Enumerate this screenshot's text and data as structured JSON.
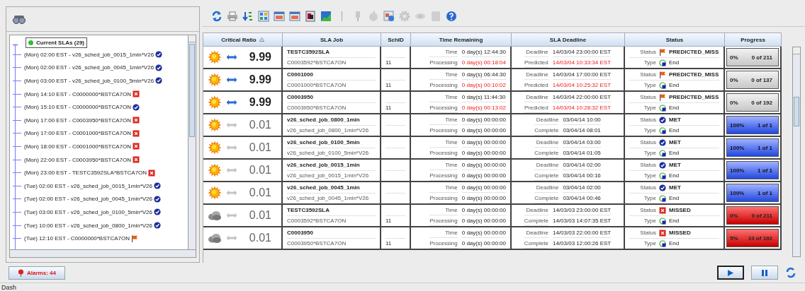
{
  "tree": {
    "root": {
      "label": "Current SLAs (29)",
      "expanded": true
    },
    "items": [
      {
        "label": "(Mon) 02:00 EST - v26_sched_job_0015_1min*V26",
        "kind": "met"
      },
      {
        "label": "(Mon) 02:00 EST - v26_sched_job_0045_1min*V26",
        "kind": "met"
      },
      {
        "label": "(Mon) 03:00 EST - v26_sched_job_0100_5min*V26",
        "kind": "met"
      },
      {
        "label": "(Mon) 14:10 EST - C0000000*BSTCA7ON",
        "kind": "missed"
      },
      {
        "label": "(Mon) 15:10 EST - C0000000*BSTCA7ON",
        "kind": "met"
      },
      {
        "label": "(Mon) 17:00 EST - C0003950*BSTCA7ON",
        "kind": "missed"
      },
      {
        "label": "(Mon) 17:00 EST - C0001000*BSTCA7ON",
        "kind": "missed"
      },
      {
        "label": "(Mon) 18:00 EST - C0001000*BSTCA7ON",
        "kind": "missed"
      },
      {
        "label": "(Mon) 22:00 EST - C0003950*BSTCA7ON",
        "kind": "missed"
      },
      {
        "label": "(Mon) 23:00 EST - TESTC3592SLA*BSTCA7ON",
        "kind": "missed"
      },
      {
        "label": "(Tue) 02:00 EST - v26_sched_job_0015_1min*V26",
        "kind": "met"
      },
      {
        "label": "(Tue) 02:00 EST - v26_sched_job_0045_1min*V26",
        "kind": "met"
      },
      {
        "label": "(Tue) 03:00 EST - v26_sched_job_0100_5min*V26",
        "kind": "met"
      },
      {
        "label": "(Tue) 10:00 EST - v26_sched_job_0800_1min*V26",
        "kind": "met"
      },
      {
        "label": "(Tue) 12:10 EST - C0000000*BSTCA7ON",
        "kind": "predicted_miss"
      }
    ]
  },
  "table": {
    "columns": [
      "Critical Ratio",
      "SLA Job",
      "SchID",
      "Time Remaining",
      "SLA Deadline",
      "Status",
      "Progress"
    ],
    "rows": [
      {
        "kind": "pending",
        "sunny": true,
        "trend_active": true,
        "ratio": "9.99",
        "job": "TESTC3592SLA",
        "job_id": "C0003592*BSTCA7ON",
        "schid": "11",
        "time_label": "Time",
        "time": "0 day(s) 12:44:30",
        "proc_label": "Processing",
        "processing": "0 day(s) 00:18:04",
        "proc_late": true,
        "deadline_label": "Deadline",
        "deadline": "14/03/04 23:00:00 EST",
        "second_label": "Predicted",
        "second": "14/03/04 10:33:34 EST",
        "second_late": true,
        "status_label": "Status",
        "status": "PREDICTED_MISS",
        "type_label": "Type",
        "type": "End",
        "percent": "0%",
        "count": "0 of 211"
      },
      {
        "kind": "pending",
        "sunny": true,
        "trend_active": true,
        "ratio": "9.99",
        "job": "C0001000",
        "job_id": "C0001000*BSTCA7ON",
        "schid": "11",
        "time_label": "Time",
        "time": "0 day(s) 06:44:30",
        "proc_label": "Processing",
        "processing": "0 day(s) 00:10:02",
        "proc_late": true,
        "deadline_label": "Deadline",
        "deadline": "14/03/04 17:00:00 EST",
        "second_label": "Predicted",
        "second": "14/03/04 10:25:32 EST",
        "second_late": true,
        "status_label": "Status",
        "status": "PREDICTED_MISS",
        "type_label": "Type",
        "type": "End",
        "percent": "0%",
        "count": "0 of 137"
      },
      {
        "kind": "pending",
        "sunny": true,
        "trend_active": true,
        "ratio": "9.99",
        "job": "C0003950",
        "job_id": "C0003950*BSTCA7ON",
        "schid": "11",
        "time_label": "Time",
        "time": "0 day(s) 11:44:30",
        "proc_label": "Processing",
        "processing": "0 day(s) 00:13:02",
        "proc_late": true,
        "deadline_label": "Deadline",
        "deadline": "14/03/04 22:00:00 EST",
        "second_label": "Predicted",
        "second": "14/03/04 10:28:32 EST",
        "second_late": true,
        "status_label": "Status",
        "status": "PREDICTED_MISS",
        "type_label": "Type",
        "type": "End",
        "percent": "0%",
        "count": "0 of 192"
      },
      {
        "kind": "met",
        "sunny": true,
        "trend_active": false,
        "ratio": "0.01",
        "job": "v26_sched_job_0800_1min",
        "job_id": "v26_sched_job_0800_1min*V26",
        "time_label": "Time",
        "time": "0 day(s) 00:00:00",
        "proc_label": "Processing",
        "processing": "0 day(s) 00:00:00",
        "proc_late": false,
        "deadline_label": "Deadline",
        "deadline": "03/04/14 10:00",
        "second_label": "Complete",
        "second": "03/04/14 08:01",
        "second_late": false,
        "status_label": "Status",
        "status": "MET",
        "type_label": "Type",
        "type": "End",
        "percent": "100%",
        "count": "1 of 1"
      },
      {
        "kind": "met",
        "sunny": true,
        "trend_active": false,
        "ratio": "0.01",
        "job": "v26_sched_job_0100_5min",
        "job_id": "v26_sched_job_0100_5min*V26",
        "time_label": "Time",
        "time": "0 day(s) 00:00:00",
        "proc_label": "Processing",
        "processing": "0 day(s) 00:00:00",
        "proc_late": false,
        "deadline_label": "Deadline",
        "deadline": "03/04/14 03:00",
        "second_label": "Complete",
        "second": "03/04/14 01:05",
        "second_late": false,
        "status_label": "Status",
        "status": "MET",
        "type_label": "Type",
        "type": "End",
        "percent": "100%",
        "count": "1 of 1"
      },
      {
        "kind": "met",
        "sunny": true,
        "trend_active": false,
        "ratio": "0.01",
        "job": "v26_sched_job_0015_1min",
        "job_id": "v26_sched_job_0015_1min*V26",
        "time_label": "Time",
        "time": "0 day(s) 00:00:00",
        "proc_label": "Processing",
        "processing": "0 day(s) 00:00:00",
        "proc_late": false,
        "deadline_label": "Deadline",
        "deadline": "03/04/14 02:00",
        "second_label": "Complete",
        "second": "03/04/14 00:16",
        "second_late": false,
        "status_label": "Status",
        "status": "MET",
        "type_label": "Type",
        "type": "End",
        "percent": "100%",
        "count": "1 of 1"
      },
      {
        "kind": "met",
        "sunny": true,
        "trend_active": false,
        "ratio": "0.01",
        "job": "v26_sched_job_0045_1min",
        "job_id": "v26_sched_job_0045_1min*V26",
        "time_label": "Time",
        "time": "0 day(s) 00:00:00",
        "proc_label": "Processing",
        "processing": "0 day(s) 00:00:00",
        "proc_late": false,
        "deadline_label": "Deadline",
        "deadline": "03/04/14 02:00",
        "second_label": "Complete",
        "second": "03/04/14 00:46",
        "second_late": false,
        "status_label": "Status",
        "status": "MET",
        "type_label": "Type",
        "type": "End",
        "percent": "100%",
        "count": "1 of 1"
      },
      {
        "kind": "missed",
        "sunny": false,
        "trend_active": false,
        "ratio": "0.01",
        "job": "TESTC3592SLA",
        "job_id": "C0003592*BSTCA7ON",
        "schid": "11",
        "time_label": "Time",
        "time": "0 day(s) 00:00:00",
        "proc_label": "Processing",
        "processing": "0 day(s) 00:00:00",
        "proc_late": false,
        "deadline_label": "Deadline",
        "deadline": "14/03/03 23:00:00 EST",
        "second_label": "Complete",
        "second": "14/03/03 14:07:35 EST",
        "second_late": false,
        "status_label": "Status",
        "status": "MISSED",
        "type_label": "Type",
        "type": "End",
        "percent": "0%",
        "count": "0 of 211"
      },
      {
        "kind": "missed",
        "sunny": false,
        "trend_active": false,
        "ratio": "0.01",
        "job": "C0003950",
        "job_id": "C0003950*BSTCA7ON",
        "schid": "11",
        "time_label": "Time",
        "time": "0 day(s) 00:00:00",
        "proc_label": "Processing",
        "processing": "0 day(s) 00:00:00",
        "proc_late": false,
        "deadline_label": "Deadline",
        "deadline": "14/03/03 22:00:00 EST",
        "second_label": "Complete",
        "second": "14/03/03 12:00:26 EST",
        "second_late": false,
        "status_label": "Status",
        "status": "MISSED",
        "type_label": "Type",
        "type": "End",
        "percent": "5%",
        "count": "10 of 192"
      }
    ]
  },
  "alarms_button": "Alarms: 44",
  "status_bar": "Dash"
}
